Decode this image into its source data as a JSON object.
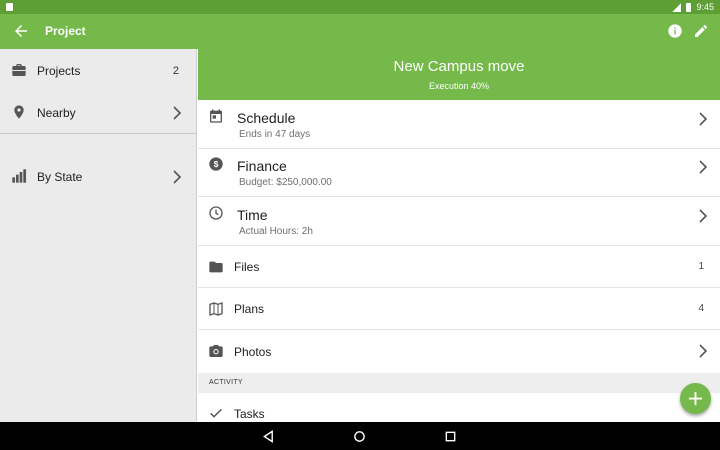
{
  "status_bar": {
    "time": "9:45"
  },
  "app_bar": {
    "title": "Project",
    "back_icon": "arrow-back-icon",
    "info_icon": "info-icon",
    "edit_icon": "pencil-icon"
  },
  "sidebar": {
    "items": [
      {
        "label": "Projects",
        "count": "2",
        "icon": "briefcase-icon"
      },
      {
        "label": "Nearby",
        "icon": "location-pin-icon"
      },
      {
        "label": "By State",
        "icon": "bar-chart-icon"
      }
    ]
  },
  "project": {
    "name": "New Campus move",
    "subtitle": "Execution 40%"
  },
  "rows": {
    "schedule": {
      "title": "Schedule",
      "subtitle": "Ends in 47 days",
      "icon": "calendar-icon"
    },
    "finance": {
      "title": "Finance",
      "subtitle": "Budget: $250,000.00",
      "icon": "dollar-icon"
    },
    "time": {
      "title": "Time",
      "subtitle": "Actual Hours: 2h",
      "icon": "clock-icon"
    },
    "files": {
      "label": "Files",
      "count": "1",
      "icon": "folder-icon"
    },
    "plans": {
      "label": "Plans",
      "count": "4",
      "icon": "map-icon"
    },
    "photos": {
      "label": "Photos",
      "icon": "camera-icon"
    }
  },
  "activity": {
    "header": "ACTIVITY",
    "items": [
      {
        "label": "Tasks",
        "icon": "check-icon"
      }
    ]
  },
  "colors": {
    "primary": "#74b94a",
    "primary_dark": "#5e9f35",
    "sidebar_bg": "#ebebeb"
  }
}
